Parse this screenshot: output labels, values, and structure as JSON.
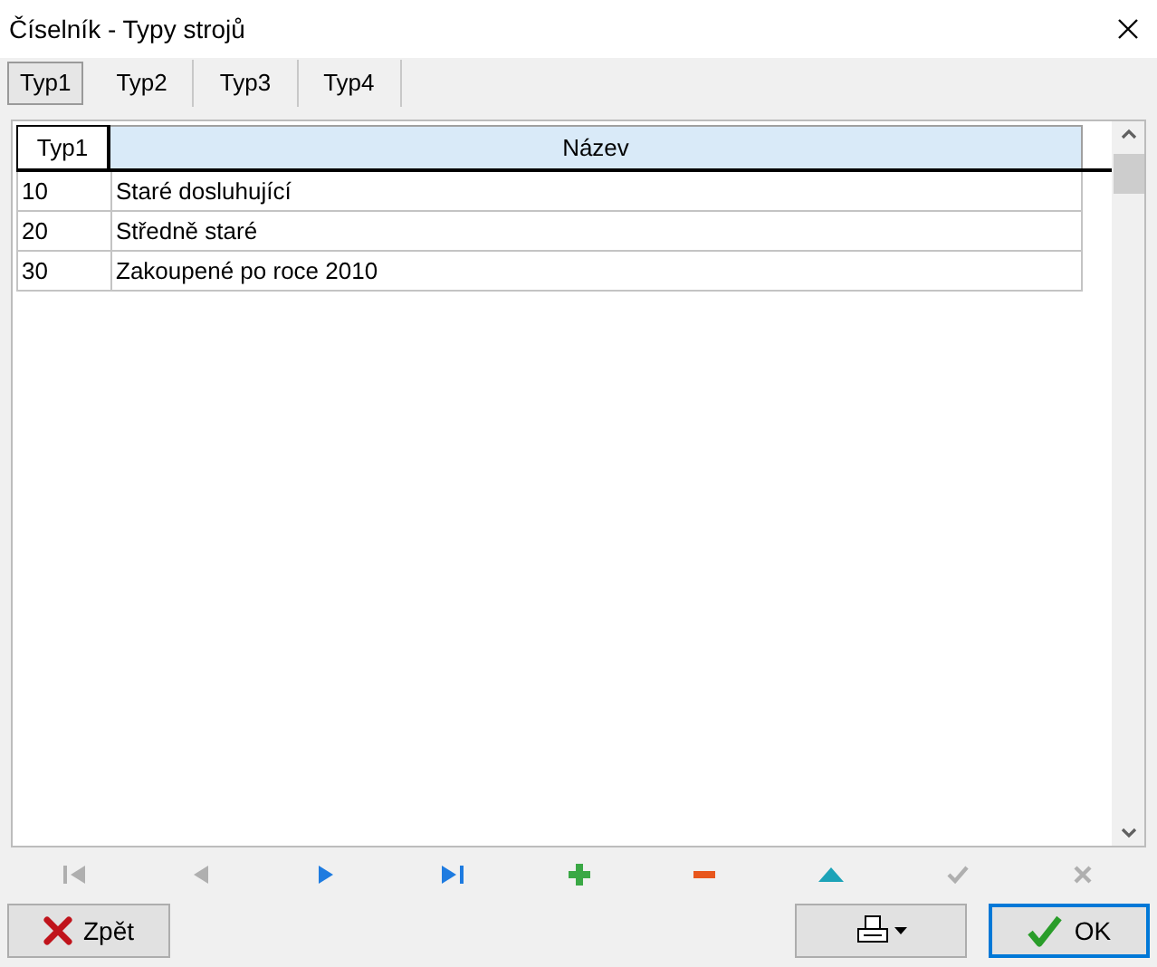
{
  "window": {
    "title": "Číselník - Typy strojů"
  },
  "tabs": [
    {
      "label": "Typ1",
      "selected": true
    },
    {
      "label": "Typ2",
      "selected": false
    },
    {
      "label": "Typ3",
      "selected": false
    },
    {
      "label": "Typ4",
      "selected": false
    }
  ],
  "table": {
    "columns": [
      {
        "label": "Typ1",
        "selected": false
      },
      {
        "label": "Název",
        "selected": true
      }
    ],
    "rows": [
      [
        "10",
        "Staré dosluhující"
      ],
      [
        "20",
        "Středně staré"
      ],
      [
        "30",
        "Zakoupené po roce 2010"
      ]
    ]
  },
  "navigator": [
    {
      "kind": "first",
      "disabled": true
    },
    {
      "kind": "prior",
      "disabled": true
    },
    {
      "kind": "next",
      "disabled": false
    },
    {
      "kind": "last",
      "disabled": false
    },
    {
      "kind": "insert",
      "disabled": false
    },
    {
      "kind": "delete",
      "disabled": false
    },
    {
      "kind": "edit",
      "disabled": false
    },
    {
      "kind": "post",
      "disabled": true
    },
    {
      "kind": "cancel",
      "disabled": true
    }
  ],
  "buttons": {
    "back": "Zpět",
    "ok": "OK"
  }
}
